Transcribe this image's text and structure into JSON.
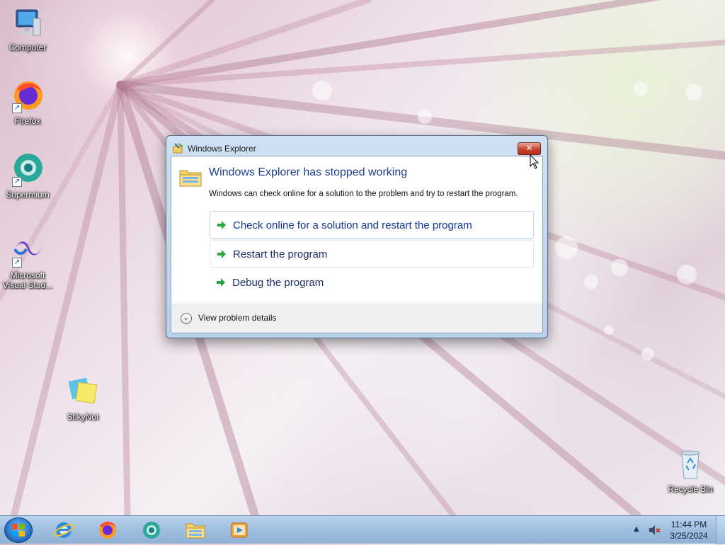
{
  "desktop": {
    "icons": [
      {
        "label": "Computer"
      },
      {
        "label": "Firefox"
      },
      {
        "label": "Supermium"
      },
      {
        "label": "Microsoft Visual Stud..."
      },
      {
        "label": "StikyNot"
      },
      {
        "label": "Recycle Bin"
      }
    ]
  },
  "dialog": {
    "title": "Windows Explorer",
    "close_icon": "close-icon",
    "heading": "Windows Explorer has stopped working",
    "description": "Windows can check online for a solution to the problem and try to restart the program.",
    "options": [
      {
        "label": "Check online for a solution and restart the program"
      },
      {
        "label": "Restart the program"
      },
      {
        "label": "Debug the program"
      }
    ],
    "details_label": "View problem details"
  },
  "taskbar": {
    "items": [
      "internet-explorer-icon",
      "firefox-icon",
      "supermium-icon",
      "file-explorer-icon",
      "media-player-icon"
    ],
    "clock": {
      "time": "11:44 PM",
      "date": "3/25/2024"
    }
  },
  "colors": {
    "heading": "#1f3f8c",
    "arrow": "#2aa839",
    "close": "#c7432e"
  }
}
